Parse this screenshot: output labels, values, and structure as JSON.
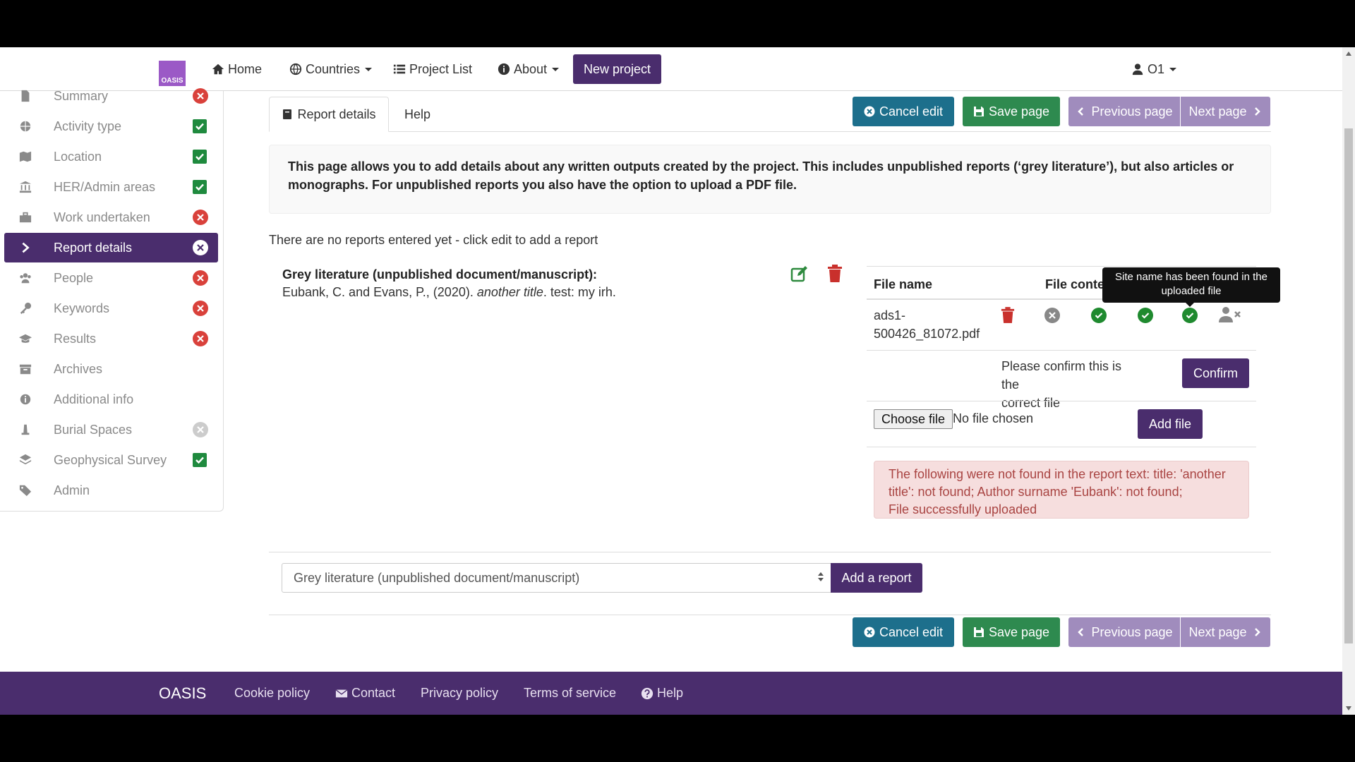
{
  "nav": {
    "logo_text": "OASIS",
    "home": "Home",
    "countries": "Countries",
    "project_list": "Project List",
    "about": "About",
    "new_project": "New project",
    "user": "O1"
  },
  "sidebar": {
    "items": [
      {
        "label": "Summary",
        "status": "error"
      },
      {
        "label": "Activity type",
        "status": "complete"
      },
      {
        "label": "Location",
        "status": "complete"
      },
      {
        "label": "HER/Admin areas",
        "status": "complete"
      },
      {
        "label": "Work undertaken",
        "status": "error"
      },
      {
        "label": "Report details",
        "status": "active"
      },
      {
        "label": "People",
        "status": "error"
      },
      {
        "label": "Keywords",
        "status": "error"
      },
      {
        "label": "Results",
        "status": "error"
      },
      {
        "label": "Archives",
        "status": "none"
      },
      {
        "label": "Additional info",
        "status": "none"
      },
      {
        "label": "Burial Spaces",
        "status": "disabled"
      },
      {
        "label": "Geophysical Survey",
        "status": "complete"
      },
      {
        "label": "Admin",
        "status": "none"
      }
    ]
  },
  "tabs": {
    "report_details": "Report details",
    "help": "Help"
  },
  "toolbar": {
    "cancel": "Cancel edit",
    "save": "Save page",
    "prev": "Previous page",
    "next": "Next page"
  },
  "info_text": "This page allows you to add details about any written outputs created by the project. This includes unpublished reports (‘grey literature’), but also articles or monographs. For unpublished reports you also have the option to upload a PDF file.",
  "no_reports": "There are no reports entered yet - click edit to add a report",
  "report": {
    "title": "Grey literature (unpublished document/manuscript):",
    "cite_authors": "Eubank, C. and Evans, P., (2020). ",
    "cite_title": "another title",
    "cite_rest": ". test: my irh."
  },
  "file_table": {
    "col_name": "File name",
    "col_content": "File conte",
    "file_name_line1": "ads1-",
    "file_name_line2": "500426_81072.pdf",
    "tooltip_line1": "Site name has been found in the",
    "tooltip_line2": "uploaded file",
    "confirm_text_line1": "Please confirm this is the",
    "confirm_text_line2": "correct file",
    "confirm_button": "Confirm",
    "choose_file": "Choose file",
    "no_file": "No file chosen",
    "add_file": "Add file"
  },
  "alert": {
    "line1": "The following were not found in the report text: title: 'another",
    "line2": "title': not found; Author surname 'Eubank': not found;",
    "line3": "File successfully uploaded"
  },
  "report_type_select": {
    "value": "Grey literature (unpublished document/manuscript)"
  },
  "add_report": "Add a report",
  "footer": {
    "brand": "OASIS",
    "cookie": "Cookie policy",
    "contact": "Contact",
    "privacy": "Privacy policy",
    "terms": "Terms of service",
    "help": "Help"
  },
  "colors": {
    "brand_purple": "#4a2d6d",
    "teal": "#1d6f8c",
    "green": "#2e8a4f",
    "lavender": "#a08cbd",
    "error_red": "#d9413b",
    "success_green": "#1f8a3e"
  }
}
